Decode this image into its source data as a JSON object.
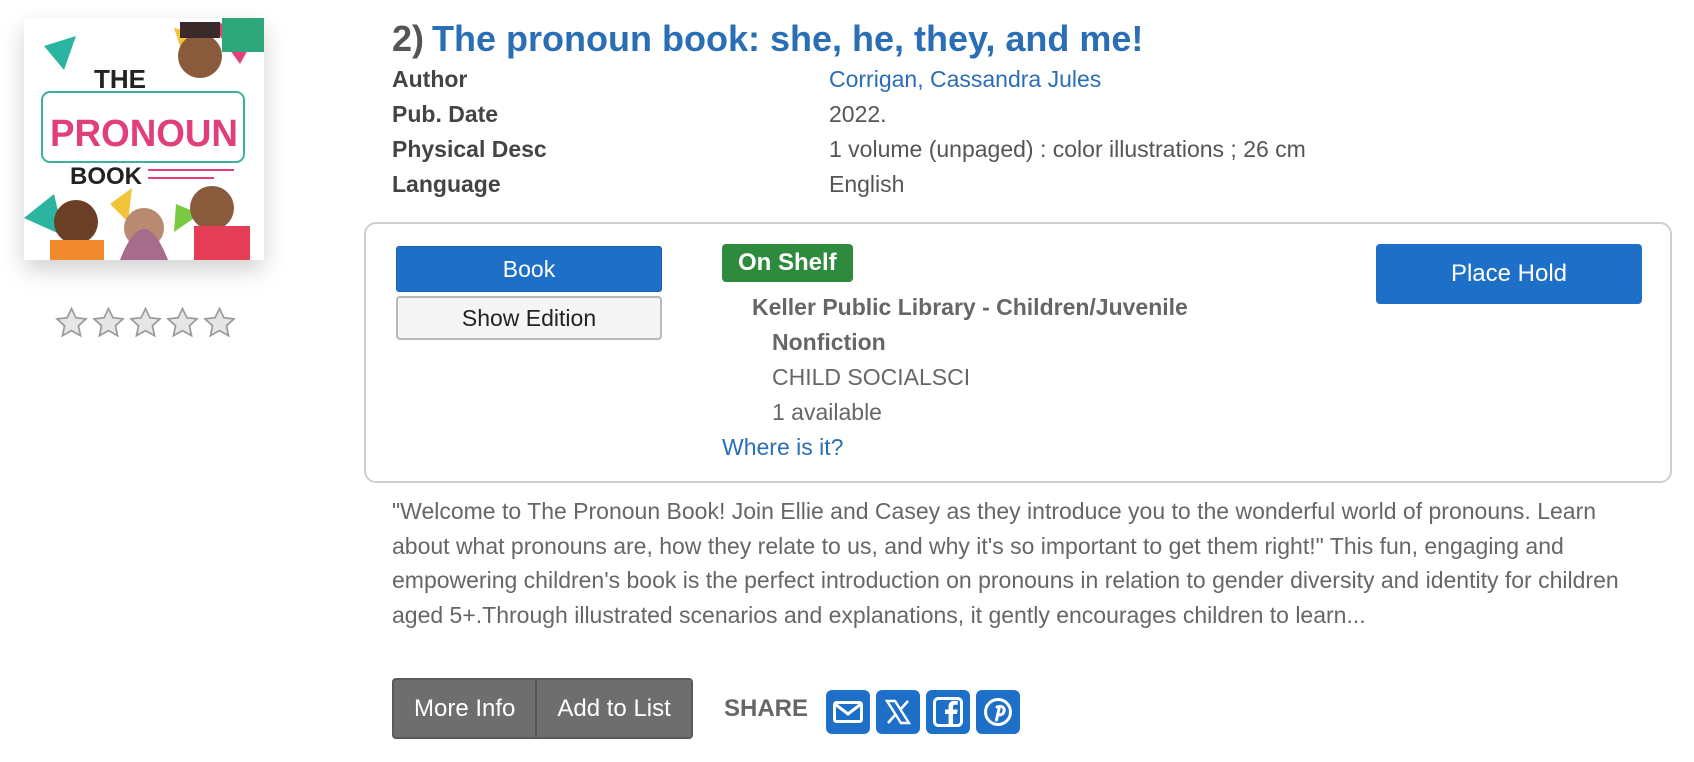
{
  "result": {
    "number": "2)",
    "title": "The pronoun book: she, he, they, and me!",
    "cover": {
      "line1": "THE",
      "line2": "PRONOUN",
      "line3": "BOOK"
    },
    "rating": {
      "stars_filled": 0,
      "stars_total": 5
    }
  },
  "details": [
    {
      "label": "Author",
      "value": "Corrigan, Cassandra Jules",
      "is_link": true
    },
    {
      "label": "Pub. Date",
      "value": "2022.",
      "is_link": false
    },
    {
      "label": "Physical Desc",
      "value": "1 volume (unpaged) : color illustrations ; 26 cm",
      "is_link": false
    },
    {
      "label": "Language",
      "value": "English",
      "is_link": false
    }
  ],
  "holdings": {
    "format_button": "Book",
    "edition_button": "Show Edition",
    "status_badge": "On Shelf",
    "location_line1": "Keller Public Library - Children/Juvenile",
    "location_line2": "Nonfiction",
    "call_number": "CHILD SOCIALSCI",
    "availability": "1 available",
    "where_link": "Where is it?",
    "hold_button": "Place Hold"
  },
  "summary": "\"Welcome to The Pronoun Book! Join Ellie and Casey as they introduce you to the wonderful world of pronouns. Learn about what pronouns are, how they relate to us, and why it's so important to get them right!\" This fun, engaging and empowering children's book is the perfect introduction on pronouns in relation to gender diversity and identity for children aged 5+.Through illustrated scenarios and explanations, it gently encourages children to learn...",
  "actions": {
    "more_info": "More Info",
    "add_to_list": "Add to List",
    "share_label": "SHARE",
    "share_icons": [
      "email-icon",
      "x-twitter-icon",
      "facebook-icon",
      "pinterest-icon"
    ]
  },
  "colors": {
    "link": "#2a6eb5",
    "primary_button": "#1e6fc7",
    "status_green": "#2e8a3c",
    "secondary_button": "#6e6e6e"
  }
}
